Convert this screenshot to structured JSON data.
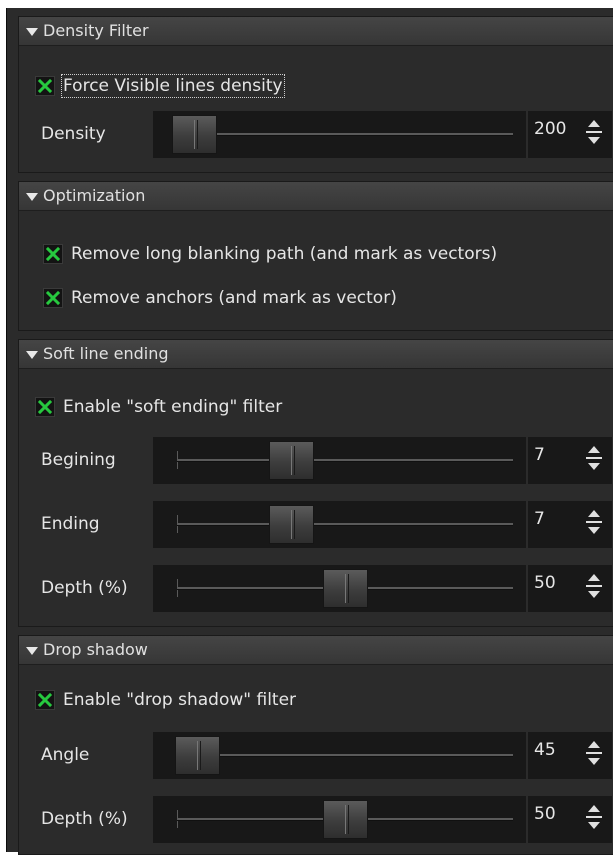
{
  "density_filter": {
    "title": "Density Filter",
    "force_checkbox": {
      "label": "Force Visible lines density",
      "checked": true
    },
    "density": {
      "label": "Density",
      "value": "200",
      "level": 0.05
    }
  },
  "optimization": {
    "title": "Optimization",
    "remove_blanking": {
      "label": "Remove long blanking path (and mark as vectors)",
      "checked": true
    },
    "remove_anchors": {
      "label": "Remove anchors (and mark as vector)",
      "checked": true
    }
  },
  "soft_line_ending": {
    "title": "Soft line ending",
    "enable": {
      "label": "Enable \"soft ending\" filter",
      "checked": true
    },
    "begining": {
      "label": "Begining",
      "value": "7",
      "level": 0.34
    },
    "ending": {
      "label": "Ending",
      "value": "7",
      "level": 0.34
    },
    "depth": {
      "label": "Depth (%)",
      "value": "50",
      "level": 0.5
    }
  },
  "drop_shadow": {
    "title": "Drop shadow",
    "enable": {
      "label": "Enable \"drop shadow\" filter",
      "checked": true
    },
    "angle": {
      "label": "Angle",
      "value": "45",
      "level": 0.06
    },
    "depth": {
      "label": "Depth (%)",
      "value": "50",
      "level": 0.5
    }
  },
  "colors": {
    "panel_bg": "#2b2b2b",
    "check_green": "#27c93f",
    "text": "#e6e6e6"
  }
}
